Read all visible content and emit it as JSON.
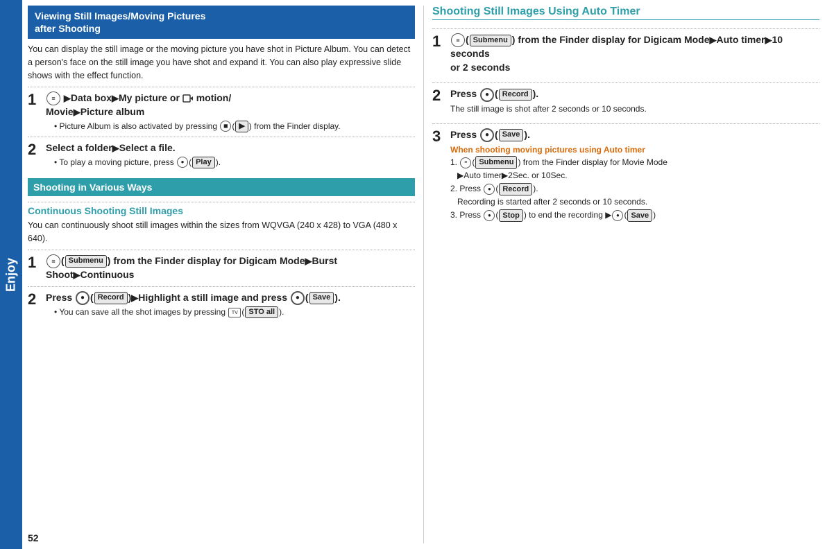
{
  "sidebar": {
    "label": "Enjoy"
  },
  "left": {
    "section1": {
      "title": "Viewing Still Images/Moving Pictures after Shooting",
      "body": "You can display the still image or the moving picture you have shot in Picture Album. You can detect a person's face on the still image you have shot and expand it. You can also play expressive slide shows with the effect function.",
      "steps": [
        {
          "number": "1",
          "text": "(menu) ▶Data box▶My picture or  motion/Movie▶Picture album",
          "bullets": [
            "Picture Album is also activated by pressing (◼)(▶) from the Finder display."
          ]
        },
        {
          "number": "2",
          "text": "Select a folder▶Select a file.",
          "bullets": [
            "To play a moving picture, press (◉)( Play )."
          ]
        }
      ]
    },
    "section2": {
      "title": "Shooting in Various Ways"
    },
    "section3": {
      "title": "Continuous Shooting Still Images",
      "body": "You can continuously shoot still images within the sizes from WQVGA (240 x 428) to VGA (480 x 640).",
      "steps": [
        {
          "number": "1",
          "text": "(menu)( Submenu ) from the Finder display for Digicam Mode▶Burst Shoot▶Continuous"
        },
        {
          "number": "2",
          "text": "Press (◉)( Record )▶Highlight a still image and press (◉)( Save ).",
          "bullets": [
            "You can save all the shot images by pressing (tv)( STO all )."
          ]
        }
      ]
    }
  },
  "right": {
    "section_title": "Shooting Still Images Using Auto Timer",
    "steps": [
      {
        "number": "1",
        "text": "(menu)( Submenu ) from the Finder display for Digicam Mode▶Auto timer▶10 seconds or 2 seconds"
      },
      {
        "number": "2",
        "text": "Press (◉)( Record ).",
        "sub": "The still image is shot after 2 seconds or 10 seconds."
      },
      {
        "number": "3",
        "text": "Press (◉)( Save ).",
        "subheading": "When shooting moving pictures using Auto timer",
        "sub_steps": [
          "1. (menu)( Submenu ) from the Finder display for Movie Mode ▶Auto timer▶2Sec. or 10Sec.",
          "2. Press (◉)( Record ).",
          "   Recording is started after 2 seconds or 10 seconds.",
          "3. Press (◉)( Stop ) to end the recording ▶(◉)( Save )"
        ]
      }
    ]
  },
  "page_number": "52",
  "buttons": {
    "play": "Play",
    "record": "Record",
    "save": "Save",
    "stop": "Stop",
    "submenu": "Submenu",
    "sto_all": "STO all"
  }
}
